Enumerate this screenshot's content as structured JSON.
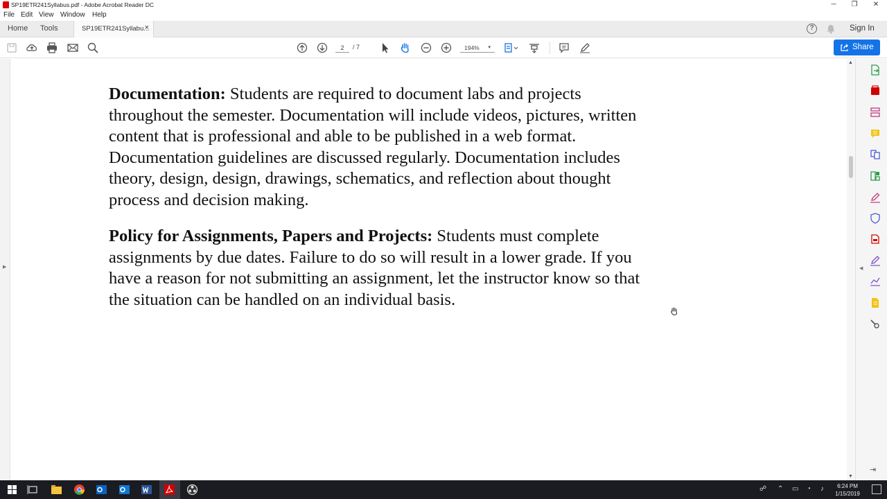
{
  "window": {
    "title": "SP19ETR241Syllabus.pdf - Adobe Acrobat Reader DC",
    "minimize_glyph": "─",
    "restore_glyph": "❐",
    "close_glyph": "✕"
  },
  "menu": [
    "File",
    "Edit",
    "View",
    "Window",
    "Help"
  ],
  "tabs": {
    "home": "Home",
    "tools": "Tools",
    "document": "SP19ETR241Syllabu...",
    "close_glyph": "×",
    "help_glyph": "?",
    "sign_in": "Sign In"
  },
  "toolbar": {
    "current_page": "2",
    "total_pages": "/ 7",
    "zoom": "194%",
    "zoom_caret": "▾",
    "share_label": "Share",
    "icons": [
      "save-icon",
      "upload-icon",
      "print-icon",
      "email-icon",
      "search-icon",
      "previous-page-icon",
      "next-page-icon",
      "select-cursor-icon",
      "hand-tool-icon",
      "zoom-out-icon",
      "zoom-in-icon",
      "page-view-icon",
      "scroll-mode-icon",
      "comment-icon",
      "highlight-pen-icon"
    ]
  },
  "document": {
    "para1_heading": "Documentation:",
    "para1_lines": [
      " Students are required to document labs and projects",
      "throughout the semester. Documentation will include videos, pictures, written",
      "content that is professional and able to be published in a web format.",
      "Documentation guidelines are discussed regularly. Documentation includes",
      "theory, design, design, drawings, schematics, and reflection about thought",
      "process and decision making."
    ],
    "para2_heading": "Policy for Assignments, Papers and Projects:",
    "para2_lines": [
      " Students must complete",
      "assignments by due dates. Failure to do so will result in a lower grade. If you",
      "have a reason for not submitting an assignment, let the instructor know so that",
      "the situation can be handled on an individual basis."
    ]
  },
  "right_panel": {
    "icons": [
      "export-pdf-icon",
      "create-pdf-icon",
      "edit-pdf-icon",
      "comment-icon",
      "combine-files-icon",
      "organize-pages-icon",
      "fill-sign-icon",
      "protect-icon",
      "send-for-review-icon",
      "sign-icon",
      "fill-form-icon",
      "more-tools-icon",
      "customize-icon"
    ],
    "collapse_glyph": "◀",
    "pin_glyph": "⇥"
  },
  "scrollbar": {
    "up_glyph": "▲",
    "down_glyph": "▼"
  },
  "left_gutter": {
    "expand_glyph": "▶"
  },
  "taskbar": {
    "apps": [
      "start-icon",
      "task-view-icon",
      "file-explorer-icon",
      "chrome-icon",
      "outlook-icon",
      "outlook-icon-2",
      "word-icon",
      "acrobat-icon",
      "obs-icon"
    ],
    "time": "6:24 PM",
    "date": "1/15/2019"
  },
  "colors": {
    "share_blue": "#1473e6",
    "acrobat_red": "#d00000",
    "tools_green": "#2d9d4b",
    "taskbar": "#1b1b22"
  }
}
